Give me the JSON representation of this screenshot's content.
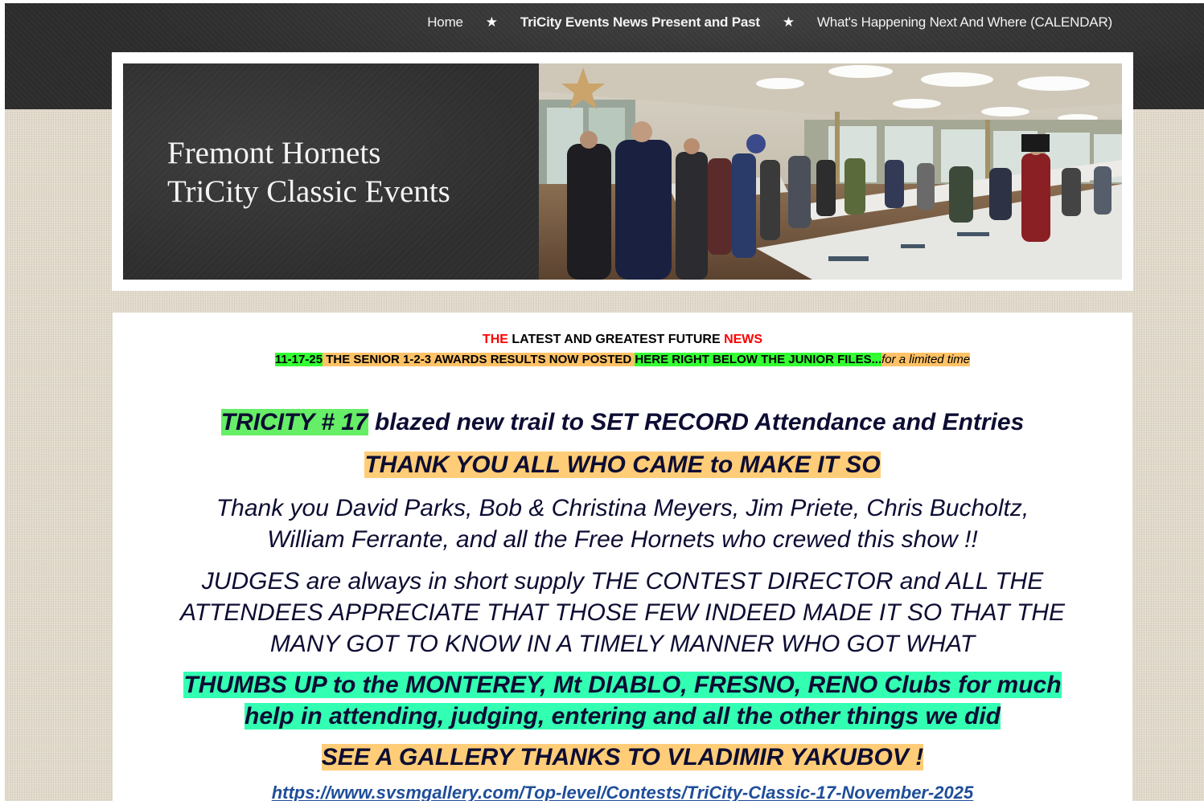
{
  "nav": {
    "items": [
      {
        "label": "Home",
        "active": false
      },
      {
        "label": "TriCity Events News Present and Past",
        "active": true
      },
      {
        "label": "What's Happening Next And Where (CALENDAR)",
        "active": false
      }
    ],
    "separator": "★"
  },
  "header": {
    "title_line1": "Fremont Hornets",
    "title_line2": "TriCity Classic Events"
  },
  "content": {
    "kicker": {
      "word1": "THE",
      "middle": " LATEST AND GREATEST FUTURE ",
      "word2": "NEWS"
    },
    "subkicker": {
      "date": "11-17-25",
      "part1": " THE SENIOR 1-2-3 AWARDS RESULTS NOW POSTED ",
      "part2": "HERE RIGHT BELOW THE JUNIOR FILES...",
      "note": "for a limited time"
    },
    "headline": {
      "highlight": "TRICITY # 17",
      "rest": " blazed new trail to SET RECORD Attendance and Entries"
    },
    "thank_you_all": "THANK YOU ALL WHO CAME to MAKE IT SO",
    "thanks_names": {
      "line1": "Thank you David Parks, Bob & Christina Meyers, Jim Priete, Chris Bucholtz,",
      "line2": "William Ferrante, and all the Free Hornets who crewed this show !!"
    },
    "judges": {
      "line1": "JUDGES are always in short supply THE CONTEST DIRECTOR and ALL THE",
      "line2": "ATTENDEES APPRECIATE THAT THOSE FEW INDEED MADE IT SO THAT THE",
      "line3": "MANY GOT TO KNOW IN A TIMELY MANNER WHO GOT WHAT"
    },
    "thumbs_up": {
      "line1": "THUMBS UP to the MONTEREY, Mt DIABLO, FRESNO, RENO Clubs for much",
      "line2": "help in attending, judging, entering and all the other things we did"
    },
    "gallery": "SEE A GALLERY THANKS TO VLADIMIR YAKUBOV !",
    "gallery_link": "https://www.svsmgallery.com/Top-level/Contests/TriCity-Classic-17-November-2025"
  },
  "colors": {
    "top_band": "#2c2c2c",
    "page_background": "#e1dacb",
    "highlight_green": "#33ff33",
    "highlight_orange": "#ffc266",
    "highlight_teal": "#33ffb3",
    "text_navy": "#0d0d33",
    "link_blue": "#1f4e99",
    "news_red": "#ff0000"
  }
}
